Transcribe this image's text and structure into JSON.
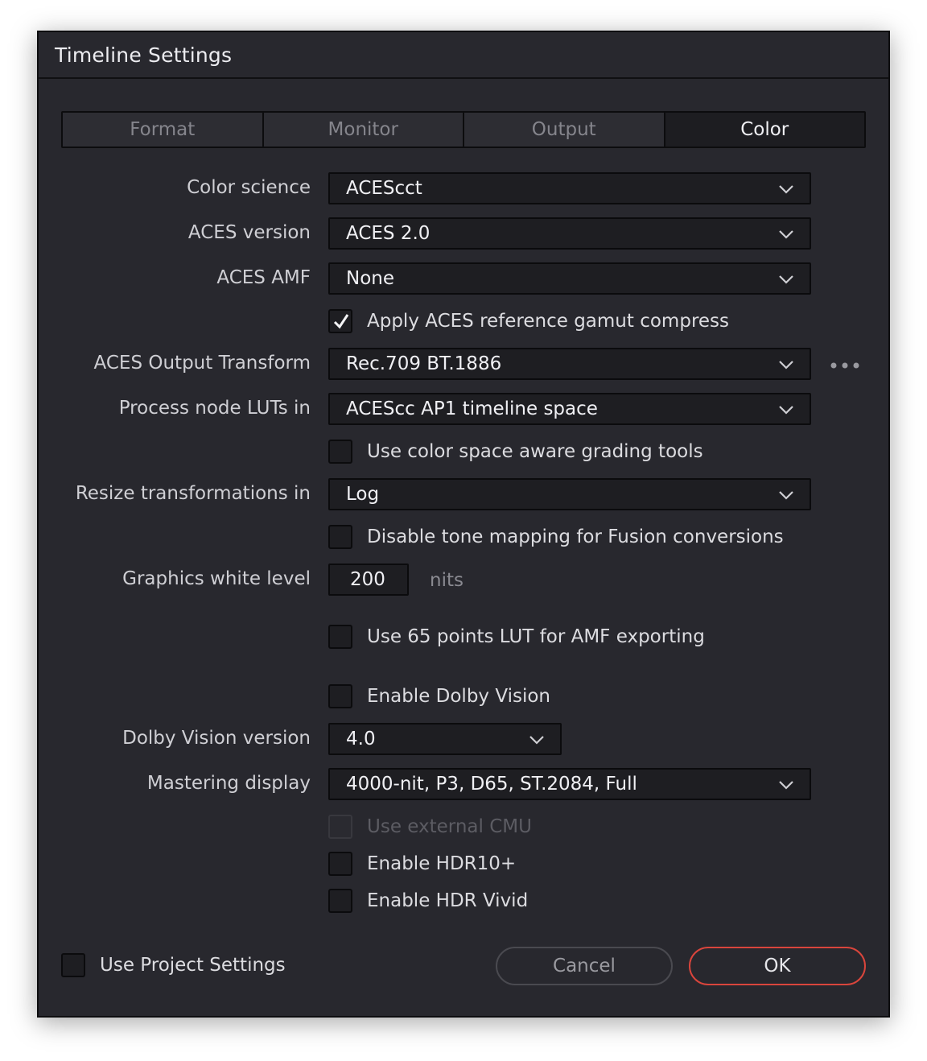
{
  "dialog": {
    "title": "Timeline Settings"
  },
  "tabs": [
    {
      "label": "Format",
      "active": false
    },
    {
      "label": "Monitor",
      "active": false
    },
    {
      "label": "Output",
      "active": false
    },
    {
      "label": "Color",
      "active": true
    }
  ],
  "fields": {
    "color_science": {
      "label": "Color science",
      "value": "ACEScct"
    },
    "aces_version": {
      "label": "ACES version",
      "value": "ACES 2.0"
    },
    "aces_amf": {
      "label": "ACES AMF",
      "value": "None"
    },
    "gamut_compress": {
      "label": "Apply ACES reference gamut compress",
      "checked": true
    },
    "output_transform": {
      "label": "ACES Output Transform",
      "value": "Rec.709 BT.1886"
    },
    "process_luts": {
      "label": "Process node LUTs in",
      "value": "ACEScc AP1 timeline space"
    },
    "color_space_aware": {
      "label": "Use color space aware grading tools",
      "checked": false
    },
    "resize_transformations": {
      "label": "Resize transformations in",
      "value": "Log"
    },
    "disable_tone_mapping": {
      "label": "Disable tone mapping for Fusion conversions",
      "checked": false
    },
    "graphics_white_level": {
      "label": "Graphics white level",
      "value": "200",
      "unit": "nits"
    },
    "lut_65_points": {
      "label": "Use 65 points LUT for AMF exporting",
      "checked": false
    },
    "enable_dolby_vision": {
      "label": "Enable Dolby Vision",
      "checked": false
    },
    "dolby_vision_version": {
      "label": "Dolby Vision version",
      "value": "4.0"
    },
    "mastering_display": {
      "label": "Mastering display",
      "value": "4000-nit, P3, D65, ST.2084, Full"
    },
    "external_cmu": {
      "label": "Use external CMU",
      "checked": false,
      "disabled": true
    },
    "hdr10_plus": {
      "label": "Enable HDR10+",
      "checked": false
    },
    "hdr_vivid": {
      "label": "Enable HDR Vivid",
      "checked": false
    }
  },
  "footer": {
    "use_project_settings": {
      "label": "Use Project Settings",
      "checked": false
    },
    "cancel_label": "Cancel",
    "ok_label": "OK"
  },
  "colors": {
    "background": "#28282e",
    "field_background": "#1e1e22",
    "ok_border": "#d9453c"
  },
  "icons": {
    "dropdown": "chevron-down-icon",
    "more": "more-options-icon",
    "check": "checkmark-icon"
  }
}
